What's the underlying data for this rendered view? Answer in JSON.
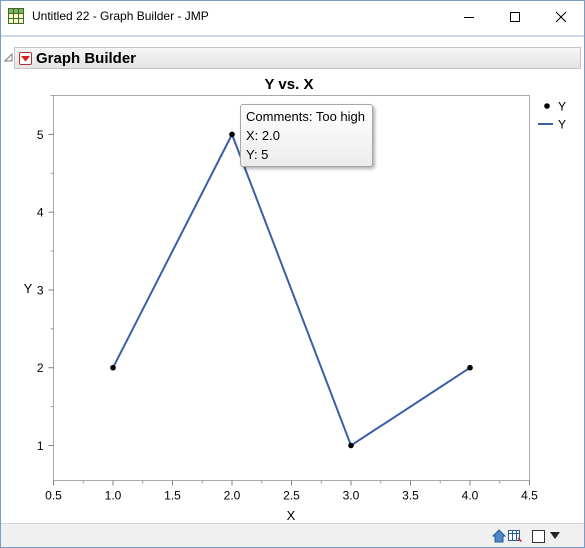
{
  "window": {
    "title": "Untitled 22 - Graph Builder - JMP",
    "icon": "jmp-grid-icon",
    "controls": [
      "minimize-icon",
      "maximize-icon",
      "close-icon"
    ]
  },
  "report": {
    "outline_title": "Graph Builder",
    "menu_icon": "red-triangle-menu-icon",
    "collapse_icon": "disclosure-triangle-icon"
  },
  "chart_data": {
    "type": "line",
    "title": "Y vs. X",
    "xlabel": "X",
    "ylabel": "Y",
    "xlim": [
      0.5,
      4.5
    ],
    "ylim": [
      0.55,
      5.5
    ],
    "x_ticks": [
      0.5,
      1.0,
      1.5,
      2.0,
      2.5,
      3.0,
      3.5,
      4.0,
      4.5
    ],
    "x_tick_labels": [
      "0.5",
      "1.0",
      "1.5",
      "2.0",
      "2.5",
      "3.0",
      "3.5",
      "4.0",
      "4.5"
    ],
    "y_ticks": [
      1,
      2,
      3,
      4,
      5
    ],
    "y_tick_labels": [
      "1",
      "2",
      "3",
      "4",
      "5"
    ],
    "series": [
      {
        "name": "Y",
        "x": [
          1.0,
          2.0,
          3.0,
          4.0
        ],
        "y": [
          2,
          5,
          1,
          2
        ],
        "marker": "point",
        "color": "#000000"
      },
      {
        "name": "Y",
        "x": [
          1.0,
          2.0,
          3.0,
          4.0
        ],
        "y": [
          2,
          5,
          1,
          2
        ],
        "marker": "line",
        "color": "#3c5ea5"
      }
    ],
    "minor_ticks": true,
    "grid": false,
    "legend_position": "right"
  },
  "tooltip": {
    "line1": "Comments: Too high",
    "line2": "X: 2.0",
    "line3": "Y: 5"
  },
  "statusbar": {
    "icons": [
      "home-icon",
      "table-icon",
      "checkbox-icon",
      "dropdown-arrow-icon"
    ]
  }
}
